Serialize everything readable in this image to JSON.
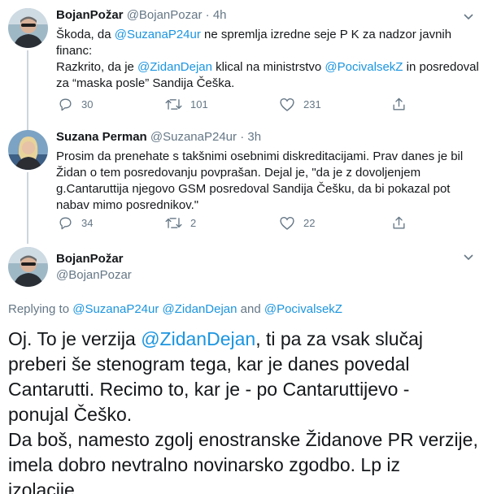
{
  "colors": {
    "link": "#1b95e0",
    "secondary": "#657786",
    "text": "#14171a",
    "line": "#ccd6dd"
  },
  "tweet1": {
    "name": "BojanPožar",
    "handle": "@BojanPozar",
    "sep": "·",
    "time": "4h",
    "line1_a": "Škoda, da ",
    "line1_mention": "@SuzanaP24ur",
    "line1_b": " ne spremlja izredne seje P K za nadzor javnih",
    "line2": "financ:",
    "line3_a": "Razkrito, da je ",
    "line3_mention1": "@ZidanDejan",
    "line3_b": " klical na ministrstvo ",
    "line3_mention2": "@PocivalsekZ",
    "line3_c": " in posredoval",
    "line4": "za “maska posle” Sandija Češka.",
    "replies": "30",
    "retweets": "101",
    "likes": "231"
  },
  "tweet2": {
    "name": "Suzana Perman",
    "handle": "@SuzanaP24ur",
    "sep": "·",
    "time": "3h",
    "lines": [
      "Prosim da prenehate s takšnimi osebnimi diskreditacijami. Prav danes je bil",
      "Židan o tem posredovanju povprašan. Dejal je,  \"da je z dovoljenjem",
      "g.Cantaruttija njegovo GSM posredoval Sandija Češku, da bi pokazal pot",
      "nabav mimo posrednikov.\""
    ],
    "replies": "34",
    "retweets": "2",
    "likes": "22"
  },
  "tweet3": {
    "name": "BojanPožar",
    "handle": "@BojanPozar",
    "replying_label": "Replying to ",
    "replying_m1": "@SuzanaP24ur",
    "replying_m2": "@ZidanDejan",
    "replying_and": " and ",
    "replying_m3": "@PocivalsekZ",
    "l1_a": "Oj. To je verzija ",
    "l1_mention": "@ZidanDejan",
    "l1_b": ", ti pa za vsak slučaj",
    "lines": [
      "preberi še stenogram tega, kar je danes povedal",
      "Cantarutti. Recimo to, kar je - po Cantaruttijevo -",
      "ponujal Češko.",
      "Da boš, namesto zgolj enostranske Židanove PR verzije,",
      "imela dobro nevtralno novinarsko zgodbo. Lp iz",
      "izolacije."
    ]
  }
}
